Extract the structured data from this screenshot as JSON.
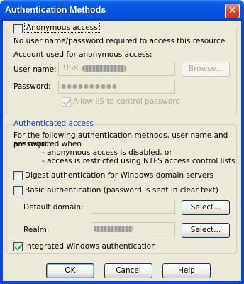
{
  "window": {
    "title": "Authentication Methods",
    "close_glyph": "✕"
  },
  "anonymous": {
    "checkbox_label": "Anonymous access",
    "checked": false,
    "description": "No user name/password required to access this resource.",
    "account_caption": "Account used for anonymous access:",
    "username_label": "User name:",
    "username_value": "IUSR_",
    "browse_label": "Browse...",
    "password_label": "Password:",
    "password_value": "●●●●●●●●●●",
    "allow_iis_label": "Allow IIS to control password",
    "allow_iis_checked": true
  },
  "authenticated": {
    "legend": "Authenticated access",
    "description_line1": "For the following authentication methods, user name and password",
    "description_line2": "are required when",
    "bullet1": "- anonymous access is disabled, or",
    "bullet2": "- access is restricted using NTFS access control lists",
    "digest_label": "Digest authentication for Windows domain servers",
    "digest_checked": false,
    "basic_label": "Basic authentication (password is sent in clear text)",
    "basic_checked": false,
    "default_domain_label": "Default domain:",
    "default_domain_value": "",
    "select_label": "Select...",
    "realm_label": "Realm:",
    "realm_select_label": "Select...",
    "integrated_label": "Integrated Windows authentication",
    "integrated_checked": true
  },
  "buttons": {
    "ok": "OK",
    "cancel": "Cancel",
    "help": "Help"
  },
  "colors": {
    "title_blue": "#0454df",
    "legend_blue": "#0046d5",
    "dialog_face": "#ece9d8"
  }
}
